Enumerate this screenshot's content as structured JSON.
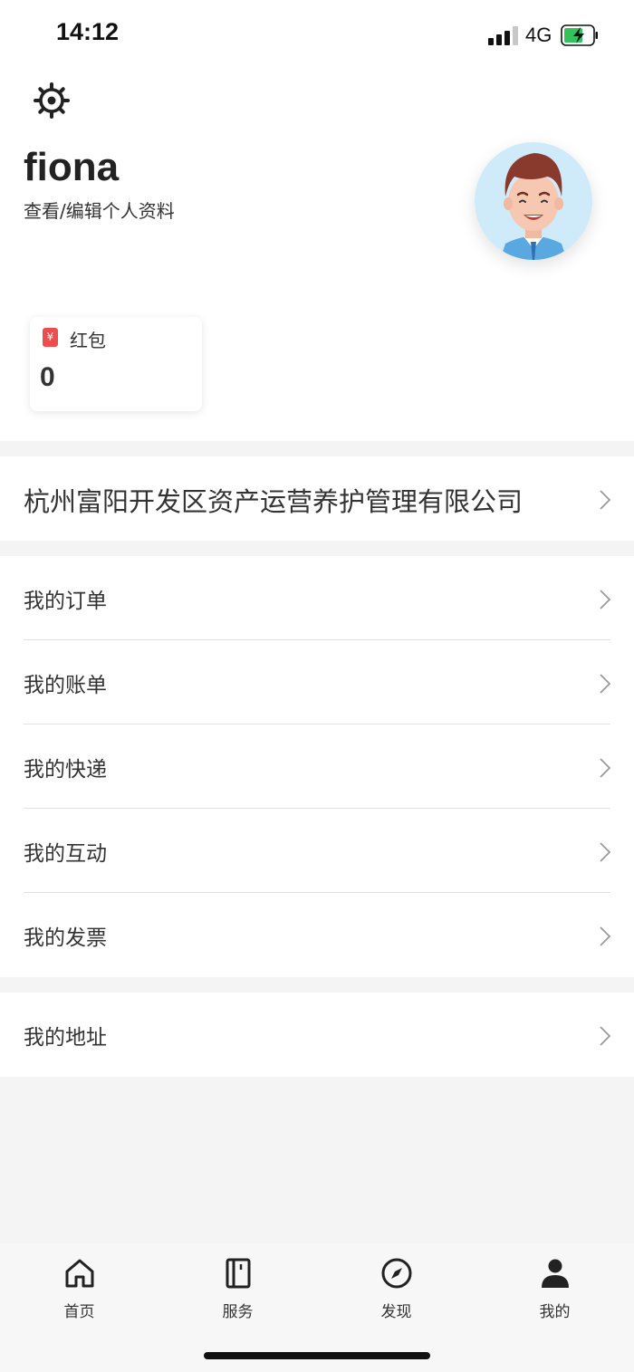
{
  "status_bar": {
    "time": "14:12",
    "network": "4G"
  },
  "profile": {
    "username": "fiona",
    "edit_link": "查看/编辑个人资料"
  },
  "hongbao": {
    "icon": "¥",
    "label": "红包",
    "value": "0"
  },
  "company": {
    "name": "杭州富阳开发区资产运营养护管理有限公司"
  },
  "menu": {
    "orders": "我的订单",
    "bills": "我的账单",
    "express": "我的快递",
    "interaction": "我的互动",
    "invoice": "我的发票",
    "address": "我的地址"
  },
  "tabs": {
    "home": "首页",
    "service": "服务",
    "discover": "发现",
    "mine": "我的"
  },
  "colors": {
    "red_packet": "#ef4d4d",
    "battery_green": "#36c25a",
    "background": "#f4f4f4"
  }
}
